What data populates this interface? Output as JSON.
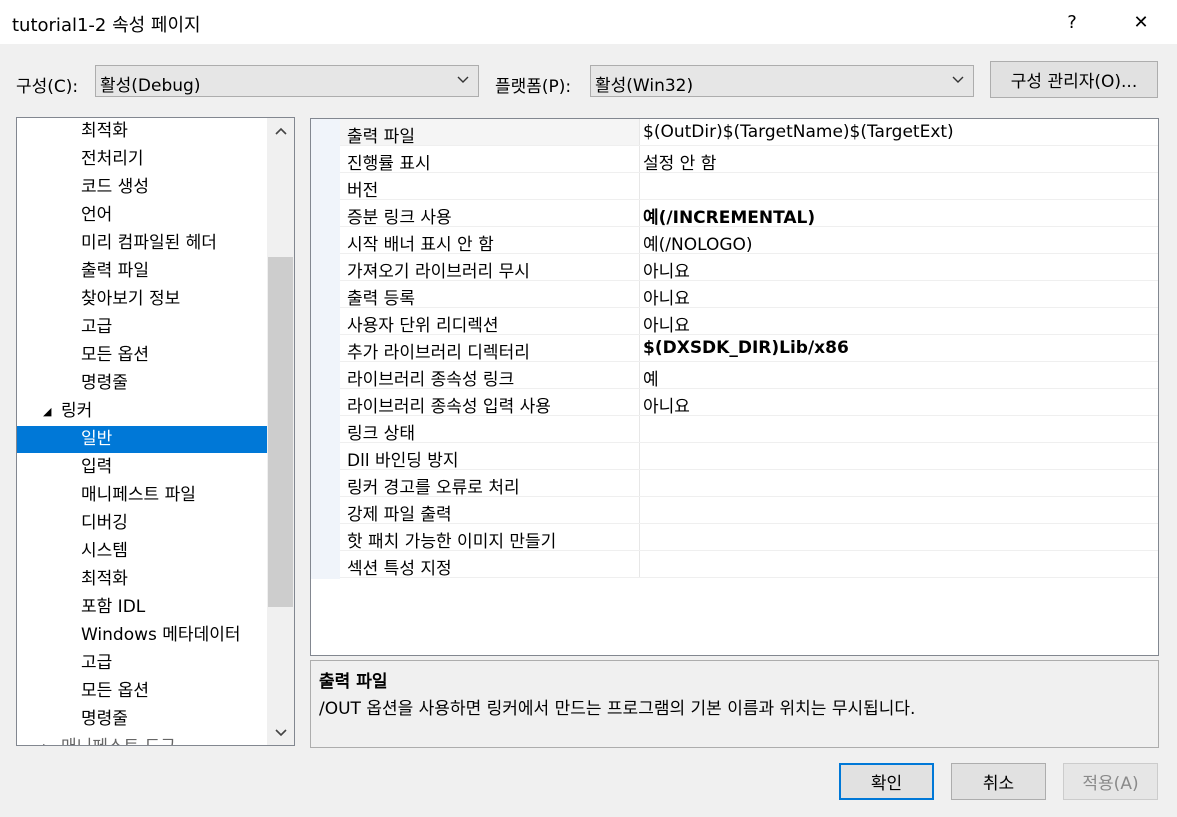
{
  "window": {
    "title": "tutorial1-2 속성 페이지",
    "help_label": "?",
    "close_label": "✕"
  },
  "toolbar": {
    "config_label": "구성(C):",
    "config_value": "활성(Debug)",
    "platform_label": "플랫폼(P):",
    "platform_value": "활성(Win32)",
    "config_manager_label": "구성 관리자(O)..."
  },
  "tree": {
    "items": [
      {
        "label": "최적화",
        "level": 2
      },
      {
        "label": "전처리기",
        "level": 2
      },
      {
        "label": "코드 생성",
        "level": 2
      },
      {
        "label": "언어",
        "level": 2
      },
      {
        "label": "미리 컴파일된 헤더",
        "level": 2
      },
      {
        "label": "출력 파일",
        "level": 2
      },
      {
        "label": "찾아보기 정보",
        "level": 2
      },
      {
        "label": "고급",
        "level": 2
      },
      {
        "label": "모든 옵션",
        "level": 2
      },
      {
        "label": "명령줄",
        "level": 2
      },
      {
        "label": "링커",
        "level": 1,
        "expanded": true
      },
      {
        "label": "일반",
        "level": 2,
        "selected": true
      },
      {
        "label": "입력",
        "level": 2
      },
      {
        "label": "매니페스트 파일",
        "level": 2
      },
      {
        "label": "디버깅",
        "level": 2
      },
      {
        "label": "시스템",
        "level": 2
      },
      {
        "label": "최적화",
        "level": 2
      },
      {
        "label": "포함 IDL",
        "level": 2
      },
      {
        "label": "Windows 메타데이터",
        "level": 2
      },
      {
        "label": "고급",
        "level": 2
      },
      {
        "label": "모든 옵션",
        "level": 2
      },
      {
        "label": "명령줄",
        "level": 2
      },
      {
        "label": "매니페스트 도구",
        "level": 1,
        "cut_off": true
      }
    ]
  },
  "properties": [
    {
      "name": "출력 파일",
      "value": "$(OutDir)$(TargetName)$(TargetExt)",
      "bold": false,
      "selected": true
    },
    {
      "name": "진행률 표시",
      "value": "설정 안 함",
      "bold": false
    },
    {
      "name": "버전",
      "value": "",
      "bold": false
    },
    {
      "name": "증분 링크 사용",
      "value": "예(/INCREMENTAL)",
      "bold": true
    },
    {
      "name": "시작 배너 표시 안 함",
      "value": "예(/NOLOGO)",
      "bold": false
    },
    {
      "name": "가져오기 라이브러리 무시",
      "value": "아니요",
      "bold": false
    },
    {
      "name": "출력 등록",
      "value": "아니요",
      "bold": false
    },
    {
      "name": "사용자 단위 리디렉션",
      "value": "아니요",
      "bold": false
    },
    {
      "name": "추가 라이브러리 디렉터리",
      "value": "$(DXSDK_DIR)Lib/x86",
      "bold": true
    },
    {
      "name": "라이브러리 종속성 링크",
      "value": "예",
      "bold": false
    },
    {
      "name": "라이브러리 종속성 입력 사용",
      "value": "아니요",
      "bold": false
    },
    {
      "name": "링크 상태",
      "value": "",
      "bold": false
    },
    {
      "name": "Dll 바인딩 방지",
      "value": "",
      "bold": false
    },
    {
      "name": "링커 경고를 오류로 처리",
      "value": "",
      "bold": false
    },
    {
      "name": "강제 파일 출력",
      "value": "",
      "bold": false
    },
    {
      "name": "핫 패치 가능한 이미지 만들기",
      "value": "",
      "bold": false
    },
    {
      "name": "섹션 특성 지정",
      "value": "",
      "bold": false
    }
  ],
  "description": {
    "title": "출력 파일",
    "text": "/OUT 옵션을 사용하면 링커에서 만드는 프로그램의 기본 이름과 위치는 무시됩니다."
  },
  "buttons": {
    "ok": "확인",
    "cancel": "취소",
    "apply": "적용(A)"
  },
  "colors": {
    "accent": "#0078d7",
    "selected_row_bg": "#f5f5f5",
    "window_bg": "#f0f0f0"
  }
}
